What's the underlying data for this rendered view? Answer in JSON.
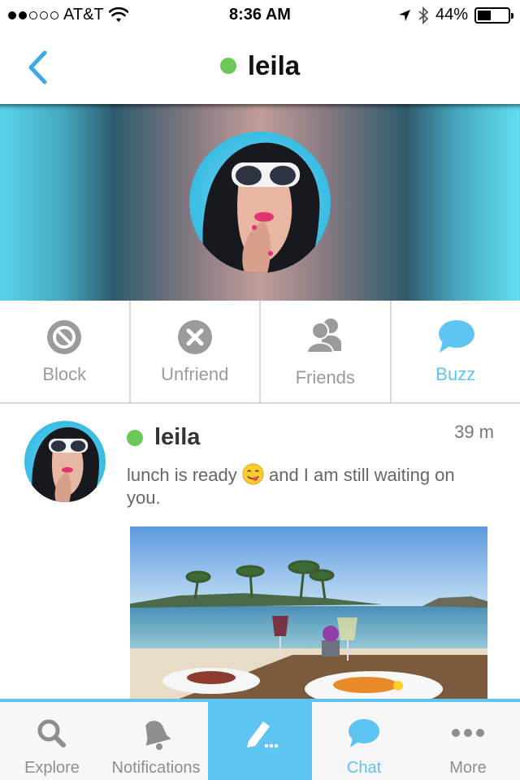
{
  "status_bar": {
    "carrier": "AT&T",
    "time": "8:36 AM",
    "battery": "44%",
    "battery_level": 0.44,
    "signal_bars_filled": 2,
    "signal_bars_total": 5
  },
  "nav": {
    "title": "leila",
    "online": true,
    "back_icon": "chevron-left-icon"
  },
  "profile": {
    "avatar": "profile-photo"
  },
  "actions": [
    {
      "label": "Block",
      "icon": "block-icon"
    },
    {
      "label": "Unfriend",
      "icon": "unfriend-icon"
    },
    {
      "label": "Friends",
      "icon": "friends-icon"
    },
    {
      "label": "Buzz",
      "icon": "chat-bubble-icon"
    }
  ],
  "post": {
    "name": "leila",
    "time": "39 m",
    "text_before": "lunch is ready ",
    "text_after": " and I am still waiting on you.",
    "emoji": "yum-face-emoji"
  },
  "tabs": [
    {
      "label": "Explore",
      "icon": "search-icon"
    },
    {
      "label": "Notifications",
      "icon": "bell-icon"
    },
    {
      "label": "",
      "icon": "compose-icon"
    },
    {
      "label": "Chat",
      "icon": "chat-bubble-icon"
    },
    {
      "label": "More",
      "icon": "more-dots-icon"
    }
  ],
  "colors": {
    "accent": "#5ec4f2",
    "online": "#6ac95a",
    "icon_gray": "#9b9b9b"
  }
}
